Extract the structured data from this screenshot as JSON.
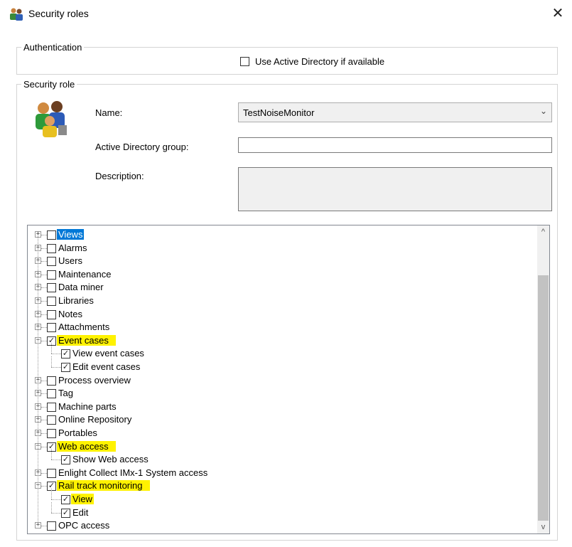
{
  "window": {
    "title": "Security roles",
    "close_glyph": "✕"
  },
  "authentication": {
    "legend": "Authentication",
    "use_ad_label": "Use Active Directory if available",
    "use_ad_checked": false
  },
  "security_role": {
    "legend": "Security role",
    "name_label": "Name:",
    "name_value": "TestNoiseMonitor",
    "ad_group_label": "Active Directory group:",
    "ad_group_value": "",
    "description_label": "Description:",
    "description_value": ""
  },
  "tree": {
    "items": [
      {
        "label": "Views",
        "level": 0,
        "expanded": false,
        "checked": false,
        "selected": true,
        "highlight": false
      },
      {
        "label": "Alarms",
        "level": 0,
        "expanded": false,
        "checked": false,
        "selected": false,
        "highlight": false
      },
      {
        "label": "Users",
        "level": 0,
        "expanded": false,
        "checked": false,
        "selected": false,
        "highlight": false
      },
      {
        "label": "Maintenance",
        "level": 0,
        "expanded": false,
        "checked": false,
        "selected": false,
        "highlight": false
      },
      {
        "label": "Data miner",
        "level": 0,
        "expanded": false,
        "checked": false,
        "selected": false,
        "highlight": false
      },
      {
        "label": "Libraries",
        "level": 0,
        "expanded": false,
        "checked": false,
        "selected": false,
        "highlight": false
      },
      {
        "label": "Notes",
        "level": 0,
        "expanded": false,
        "checked": false,
        "selected": false,
        "highlight": false
      },
      {
        "label": "Attachments",
        "level": 0,
        "expanded": false,
        "checked": false,
        "selected": false,
        "highlight": false
      },
      {
        "label": "Event cases",
        "level": 0,
        "expanded": true,
        "checked": true,
        "selected": false,
        "highlight": true
      },
      {
        "label": "View event cases",
        "level": 1,
        "checked": true,
        "selected": false,
        "highlight": false
      },
      {
        "label": "Edit event cases",
        "level": 1,
        "checked": true,
        "selected": false,
        "highlight": false
      },
      {
        "label": "Process overview",
        "level": 0,
        "expanded": false,
        "checked": false,
        "selected": false,
        "highlight": false
      },
      {
        "label": "Tag",
        "level": 0,
        "expanded": false,
        "checked": false,
        "selected": false,
        "highlight": false
      },
      {
        "label": "Machine parts",
        "level": 0,
        "expanded": false,
        "checked": false,
        "selected": false,
        "highlight": false
      },
      {
        "label": "Online Repository",
        "level": 0,
        "expanded": false,
        "checked": false,
        "selected": false,
        "highlight": false
      },
      {
        "label": "Portables",
        "level": 0,
        "expanded": false,
        "checked": false,
        "selected": false,
        "highlight": false
      },
      {
        "label": "Web access",
        "level": 0,
        "expanded": true,
        "checked": true,
        "selected": false,
        "highlight": true
      },
      {
        "label": "Show Web access",
        "level": 1,
        "checked": true,
        "selected": false,
        "highlight": false
      },
      {
        "label": "Enlight Collect IMx-1 System access",
        "level": 0,
        "expanded": false,
        "checked": false,
        "selected": false,
        "highlight": false
      },
      {
        "label": "Rail track monitoring",
        "level": 0,
        "expanded": true,
        "checked": true,
        "selected": false,
        "highlight": true
      },
      {
        "label": "View",
        "level": 1,
        "checked": true,
        "selected": false,
        "highlight": true
      },
      {
        "label": "Edit",
        "level": 1,
        "checked": true,
        "selected": false,
        "highlight": false
      },
      {
        "label": "OPC access",
        "level": 0,
        "expanded": false,
        "checked": false,
        "selected": false,
        "highlight": false
      }
    ]
  },
  "scrollbar": {
    "up_glyph": "^",
    "down_glyph": "v"
  },
  "colors": {
    "highlight": "#fff200",
    "selection": "#0078d7"
  }
}
